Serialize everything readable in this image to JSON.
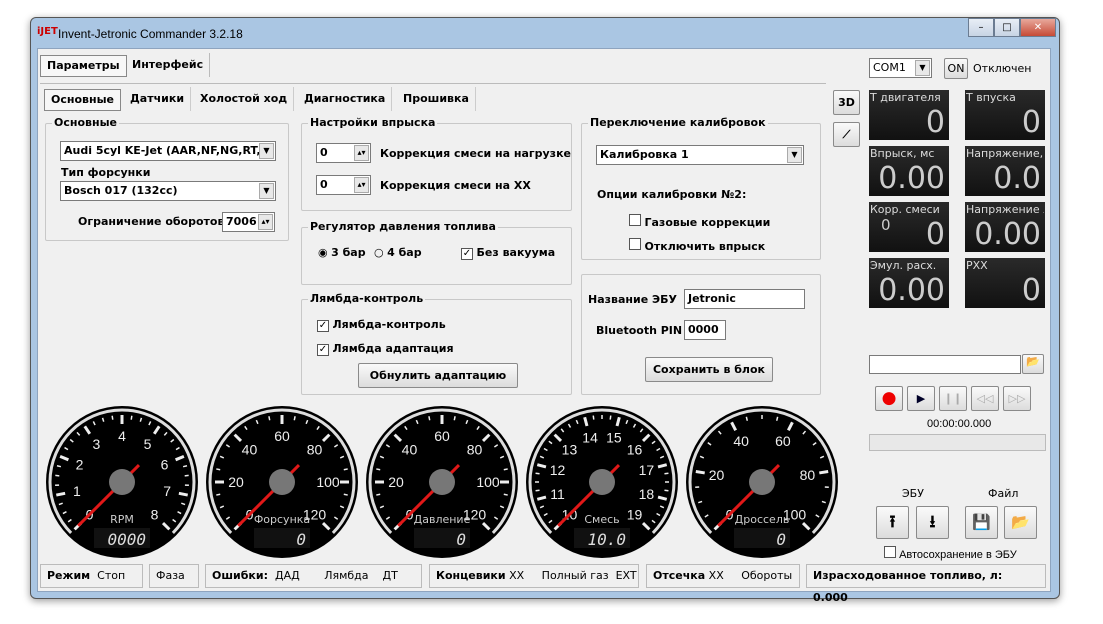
{
  "window": {
    "title": "Invent-Jetronic Commander 3.2.18",
    "logo": "iJET",
    "min": "–",
    "max": "□",
    "close": "✕"
  },
  "main_tabs": [
    "Параметры",
    "Интерфейс"
  ],
  "sub_tabs": [
    "Основные",
    "Датчики",
    "Холостой ход",
    "Диагностика",
    "Прошивка"
  ],
  "connection": {
    "port": "COM1",
    "on_label": "ON",
    "status": "Отключен"
  },
  "basic": {
    "title": "Основные",
    "engine": "Audi 5cyl KE-Jet (AAR,NF,NG,RT,",
    "injector_label": "Тип форсунки",
    "injector": "Bosch 017 (132cc)",
    "rev_limit_label": "Ограничение оборотов",
    "rev_limit": "7006"
  },
  "injection": {
    "title": "Настройки впрыска",
    "load_corr": "0",
    "load_corr_label": "Коррекция смеси на нагрузке",
    "idle_corr": "0",
    "idle_corr_label": "Коррекция смеси на XX"
  },
  "regulator": {
    "title": "Регулятор давления топлива",
    "opt1": "3 бар",
    "opt2": "4 бар",
    "selected": "3 бар",
    "no_vacuum": "Без вакуума",
    "no_vacuum_checked": true
  },
  "lambda": {
    "title": "Лямбда-контроль",
    "control": "Лямбда-контроль",
    "adapt": "Лямбда адаптация",
    "reset": "Обнулить адаптацию"
  },
  "calib": {
    "title": "Переключение калибровок",
    "selected": "Калибровка 1",
    "options_title": "Опции калибровки №2:",
    "gas": "Газовые коррекции",
    "disable_inj": "Отключить впрыск"
  },
  "ecu": {
    "name_label": "Название ЭБУ",
    "name": "Jetronic",
    "pin_label": "Bluetooth PIN",
    "pin": "0000",
    "save": "Сохранить в блок"
  },
  "side_buttons": {
    "b3d": "3D",
    "graph_icon": "chart-icon"
  },
  "readouts": [
    {
      "label": "Т двигателя",
      "value": "0"
    },
    {
      "label": "Т впуска",
      "value": "0"
    },
    {
      "label": "Впрыск, мс",
      "value": "0.00"
    },
    {
      "label": "Напряжение, В",
      "value": "0.0"
    },
    {
      "label": "Корр. смеси",
      "value": "0",
      "sub": "0"
    },
    {
      "label": "Напряжение ЛЗ",
      "value": "0.00"
    },
    {
      "label": "Эмул. расх.",
      "value": "0.00"
    },
    {
      "label": "РХХ",
      "value": "0"
    }
  ],
  "player": {
    "file": "",
    "time": "00:00:00.000",
    "progress": 0
  },
  "transfer": {
    "ecu_label": "ЭБУ",
    "file_label": "Файл",
    "autosave": "Автосохранение в ЭБУ"
  },
  "gauges": [
    {
      "name": "RPM",
      "min": 0,
      "max": 8,
      "labels": [
        0,
        1,
        2,
        3,
        4,
        5,
        6,
        7,
        8
      ],
      "display": "0000",
      "value": 0
    },
    {
      "name": "Форсунка",
      "min": 0,
      "max": 120,
      "labels": [
        0,
        20,
        40,
        60,
        80,
        100,
        120
      ],
      "display": "0",
      "value": 0
    },
    {
      "name": "Давление",
      "min": 0,
      "max": 120,
      "labels": [
        0,
        20,
        40,
        60,
        80,
        100,
        120
      ],
      "display": "0",
      "value": 0
    },
    {
      "name": "Смесь",
      "min": 10,
      "max": 19,
      "labels": [
        10,
        11,
        12,
        13,
        14,
        15,
        16,
        17,
        18,
        19
      ],
      "display": "10.0",
      "value": 10
    },
    {
      "name": "Дроссель",
      "min": 0,
      "max": 100,
      "labels": [
        0,
        20,
        40,
        60,
        80,
        100
      ],
      "display": "0",
      "value": 0
    }
  ],
  "status": {
    "mode_label": "Режим",
    "mode": "Стоп",
    "phase": "Фаза",
    "errors_label": "Ошибки:",
    "err1": "ДАД",
    "err2": "Лямбда",
    "err3": "ДТ",
    "limits_label": "Концевики",
    "lim1": "XX",
    "lim2": "Полный газ",
    "lim3": "EXT",
    "cutoff_label": "Отсечка",
    "cut1": "XX",
    "cut2": "Обороты",
    "fuel_label": "Израсходованное топливо, л:",
    "fuel": "0.000"
  }
}
